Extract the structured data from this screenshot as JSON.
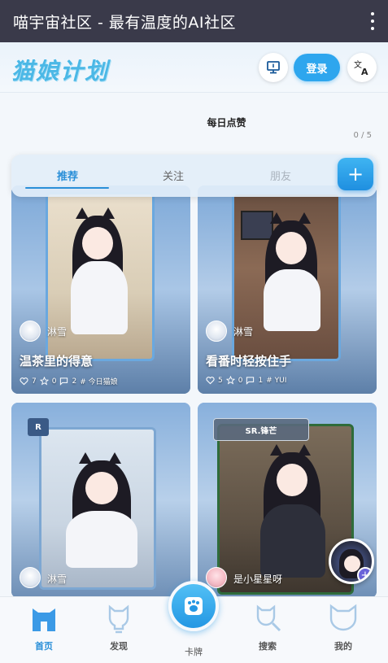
{
  "window": {
    "title": "喵宇宙社区 - 最有温度的AI社区"
  },
  "header": {
    "logo_text": "猫娘计划",
    "login_label": "登录",
    "monitor_icon": "monitor-icon",
    "language_icon": "translate-icon"
  },
  "daily": {
    "label": "每日点赞",
    "count": "0 / 5"
  },
  "tabs": [
    {
      "label": "推荐",
      "active": true
    },
    {
      "label": "关注",
      "active": false
    },
    {
      "label": "朋友",
      "active": false
    }
  ],
  "add_label": "+",
  "cards": [
    {
      "user": "淋雪",
      "title": "温茶里的得意",
      "likes": "7",
      "stars": "0",
      "comments": "2",
      "tag": "# 今日猫娘"
    },
    {
      "user": "淋雪",
      "title": "看番时轻按住手",
      "likes": "5",
      "stars": "0",
      "comments": "1",
      "tag": "# YUI"
    },
    {
      "user": "淋雪",
      "badge": "R"
    },
    {
      "user": "是小星星呀",
      "badge": "SR.锋芒"
    }
  ],
  "nav": [
    {
      "label": "首页",
      "icon": "home-cat-icon",
      "active": true
    },
    {
      "label": "发现",
      "icon": "lightbulb-cat-icon",
      "active": false
    },
    {
      "label": "卡牌",
      "icon": "paw-icon",
      "active": false
    },
    {
      "label": "搜索",
      "icon": "search-cat-icon",
      "active": false
    },
    {
      "label": "我的",
      "icon": "profile-cat-icon",
      "active": false
    }
  ],
  "colors": {
    "accent": "#2a8fd8",
    "titlebar": "#3a3a4a",
    "logo": "#4bb8e6"
  }
}
